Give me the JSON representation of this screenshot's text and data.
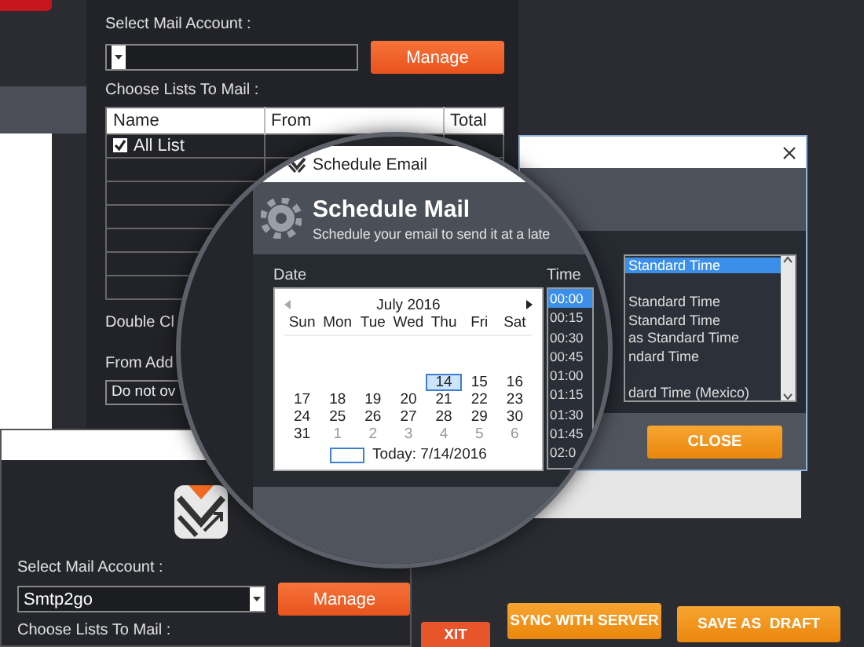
{
  "back_window": {
    "account_label": "Select Mail Account :",
    "manage_button": "Manage",
    "lists_label": "Choose Lists To Mail :",
    "columns": [
      "Name",
      "From",
      "Total"
    ],
    "lists": [
      {
        "name": "All List",
        "checked": true
      }
    ],
    "double_click_label": "Double Cl",
    "from_label": "From Add",
    "from_field_value": "Do not ov"
  },
  "schedule_dialog": {
    "title": "Schedule Email",
    "heading": "Schedule Mail",
    "subtitle": "Schedule your email to send it at a late",
    "date_label": "Date",
    "month": "July 2016",
    "weekdays": [
      "Sun",
      "Mon",
      "Tue",
      "Wed",
      "Thu",
      "Fri",
      "Sat"
    ],
    "weeks": [
      [
        {
          "day": "14",
          "selected": true,
          "other_month": false
        },
        {
          "day": "15",
          "selected": false,
          "other_month": false
        },
        {
          "day": "16",
          "selected": false,
          "other_month": false
        }
      ],
      [
        {
          "day": "17",
          "selected": false,
          "other_month": false
        },
        {
          "day": "18",
          "selected": false,
          "other_month": false
        },
        {
          "day": "19",
          "selected": false,
          "other_month": false
        },
        {
          "day": "20",
          "selected": false,
          "other_month": false
        },
        {
          "day": "21",
          "selected": false,
          "other_month": false
        },
        {
          "day": "22",
          "selected": false,
          "other_month": false
        },
        {
          "day": "23",
          "selected": false,
          "other_month": false
        }
      ],
      [
        {
          "day": "24",
          "selected": false,
          "other_month": false
        },
        {
          "day": "25",
          "selected": false,
          "other_month": false
        },
        {
          "day": "26",
          "selected": false,
          "other_month": false
        },
        {
          "day": "27",
          "selected": false,
          "other_month": false
        },
        {
          "day": "28",
          "selected": false,
          "other_month": false
        },
        {
          "day": "29",
          "selected": false,
          "other_month": false
        },
        {
          "day": "30",
          "selected": false,
          "other_month": false
        }
      ],
      [
        {
          "day": "31",
          "selected": false,
          "other_month": false
        },
        {
          "day": "1",
          "selected": false,
          "other_month": true
        },
        {
          "day": "2",
          "selected": false,
          "other_month": true
        },
        {
          "day": "3",
          "selected": false,
          "other_month": true
        },
        {
          "day": "4",
          "selected": false,
          "other_month": true
        },
        {
          "day": "5",
          "selected": false,
          "other_month": true
        },
        {
          "day": "6",
          "selected": false,
          "other_month": true
        }
      ]
    ],
    "today": "Today: 7/14/2016",
    "time_label": "Time",
    "times": [
      {
        "text": "00:00",
        "selected": true
      },
      {
        "text": "00:15",
        "selected": false
      },
      {
        "text": "00:30",
        "selected": false
      },
      {
        "text": "00:45",
        "selected": false
      },
      {
        "text": "01:00",
        "selected": false
      },
      {
        "text": "01:15",
        "selected": false
      },
      {
        "text": "01:30",
        "selected": false
      },
      {
        "text": "01:45",
        "selected": false
      },
      {
        "text": "02:0",
        "selected": false
      }
    ]
  },
  "timezone_window": {
    "timezones": [
      {
        "text": "Standard Time",
        "selected": true
      },
      {
        "text": "Standard Time",
        "selected": false
      },
      {
        "text": "Standard Time",
        "selected": false
      },
      {
        "text": "as Standard Time",
        "selected": false
      },
      {
        "text": "ndard Time",
        "selected": false
      },
      {
        "text": "dard Time (Mexico)",
        "selected": false
      }
    ],
    "close_button": "CLOSE"
  },
  "front_window": {
    "account_label": "Select Mail Account :",
    "account_value": "Smtp2go",
    "manage_button": "Manage",
    "lists_label": "Choose Lists To Mail :"
  },
  "action_buttons": [
    {
      "label": "XIT",
      "kind": "exit"
    },
    {
      "label": "SYNC WITH SERVER",
      "kind": "primary"
    },
    {
      "label": "SAVE AS  DRAFT",
      "kind": "primary"
    }
  ]
}
